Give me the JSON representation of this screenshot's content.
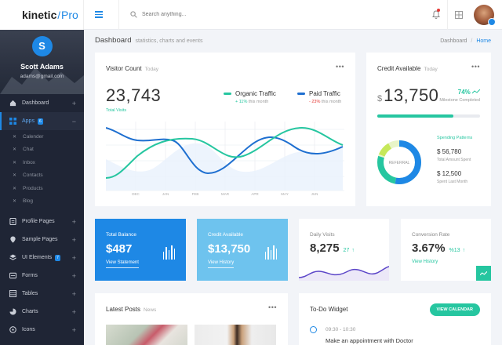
{
  "brand": {
    "part1": "kinetic",
    "part2": "Pro"
  },
  "profile": {
    "initial": "S",
    "name": "Scott Adams",
    "email": "adams@gmail.com"
  },
  "sidebar": {
    "items": [
      {
        "label": "Dashboard"
      },
      {
        "label": "Apps",
        "badge": "6"
      }
    ],
    "subitems": [
      "Calender",
      "Chat",
      "Inbox",
      "Contacts",
      "Products",
      "Blog"
    ],
    "items2": [
      {
        "label": "Profile Pages"
      },
      {
        "label": "Sample Pages"
      },
      {
        "label": "UI Elements",
        "badge": "7"
      },
      {
        "label": "Forms"
      },
      {
        "label": "Tables"
      },
      {
        "label": "Charts"
      },
      {
        "label": "Icons"
      }
    ]
  },
  "topbar": {
    "search_placeholder": "Search anything..."
  },
  "page_header": {
    "title": "Dashboard",
    "subtitle": "statistics, charts and events",
    "crumb1": "Dashboard",
    "crumb2": "Home"
  },
  "visitor": {
    "title": "Visitor Count",
    "tag": "Today",
    "value": "23,743",
    "value_label": "Total Visits",
    "organic": {
      "label": "Organic Traffic",
      "change": "+ 11%",
      "note": "this month",
      "color": "#26c6a0"
    },
    "paid": {
      "label": "Paid Traffic",
      "change": "- 23%",
      "note": "this month",
      "color": "#1e6fd0"
    },
    "months": [
      "DEC",
      "JAN",
      "FEB",
      "MAR",
      "APR",
      "MAY",
      "JUN"
    ]
  },
  "credit": {
    "title": "Credit Available",
    "tag": "Today",
    "currency": "$",
    "value": "13,750",
    "pct": "74%",
    "pct_label": "Milestone Completed",
    "progress": 0.74,
    "donut_label": "REFERRAL",
    "spending_title": "Spending Patterns",
    "amount1": "$ 56,780",
    "amount1_label": "Total Amount Spent",
    "amount2": "$ 12,500",
    "amount2_label": "Spent Last Month"
  },
  "balance": {
    "title": "Total Balance",
    "value": "$487",
    "link": "View Statement",
    "color": "#1e88e5"
  },
  "credit2": {
    "title": "Credit Available",
    "value": "$13,750",
    "link": "View History",
    "color": "#6ec3ee"
  },
  "visits": {
    "title": "Daily Visits",
    "value": "8,275",
    "change": "27"
  },
  "conversion": {
    "title": "Conversion Rate",
    "value": "3.67%",
    "change": "%13",
    "link": "View History"
  },
  "posts": {
    "title": "Latest Posts",
    "tag": "News"
  },
  "todo": {
    "title": "To-Do Widget",
    "button": "VIEW CALENDAR",
    "time": "09:30 - 10:30",
    "task": "Make an appointment with Doctor"
  }
}
